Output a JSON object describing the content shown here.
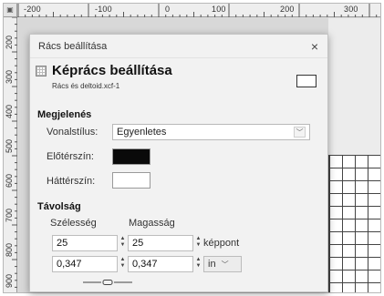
{
  "ruler": {
    "h_labels": [
      "-200",
      "-100",
      "0",
      "100",
      "200",
      "300"
    ],
    "v_labels": [
      "200",
      "300",
      "400",
      "500",
      "600",
      "700",
      "800",
      "900"
    ]
  },
  "dialog": {
    "window_title": "Rács beállítása",
    "close_glyph": "×",
    "heading": "Képrács beállítása",
    "subheading": "Rács és deltoid.xcf-1"
  },
  "appearance": {
    "section": "Megjelenés",
    "line_style_label": "Vonalstílus:",
    "line_style_value": "Egyenletes",
    "foreground_label": "Előtérszín:",
    "background_label": "Háttérszín:",
    "foreground_color": "#0a0a0a",
    "background_color": "#ffffff"
  },
  "spacing": {
    "section": "Távolság",
    "width_label": "Szélesség",
    "height_label": "Magasság",
    "width_px": "25",
    "height_px": "25",
    "unit_px": "képpont",
    "width_in": "0,347",
    "height_in": "0,347",
    "unit_in": "in"
  }
}
